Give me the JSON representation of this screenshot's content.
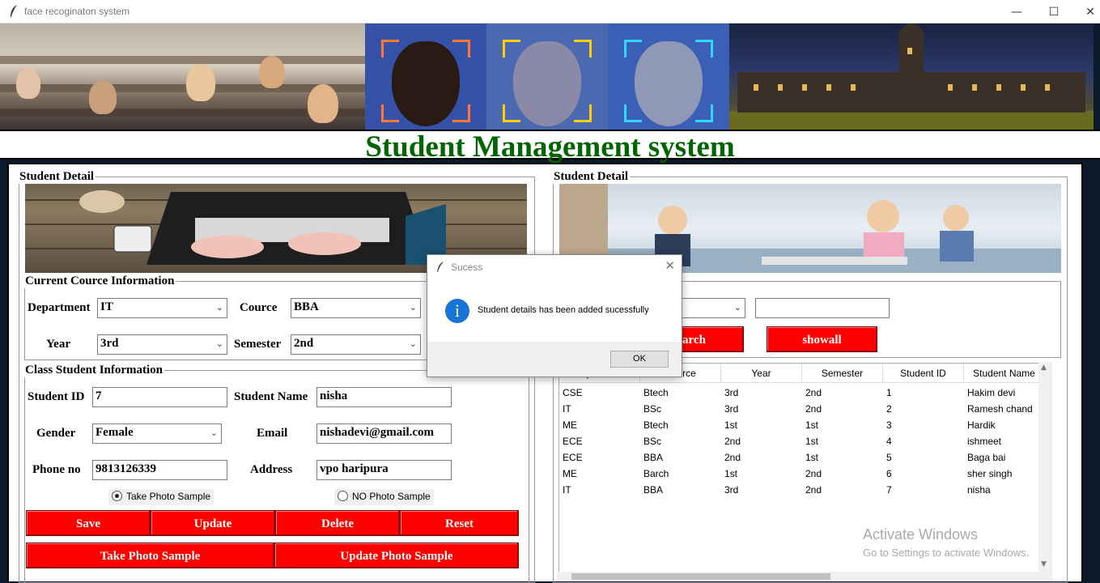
{
  "window": {
    "title": "face recoginaton system",
    "minimize": "—",
    "maximize": "☐",
    "close": "✕"
  },
  "header": {
    "title": "Student Management system"
  },
  "left_panel": {
    "label": "Student Detail",
    "course_group": {
      "label": "Current Cource Information",
      "department_label": "Department",
      "department_value": "IT",
      "course_label": "Cource",
      "course_value": "BBA",
      "year_label": "Year",
      "year_value": "3rd",
      "semester_label": "Semester",
      "semester_value": "2nd"
    },
    "class_group": {
      "label": "Class Student Information",
      "student_id_label": "Student ID",
      "student_id_value": "7",
      "student_name_label": "Student Name",
      "student_name_value": "nisha",
      "gender_label": "Gender",
      "gender_value": "Female",
      "email_label": "Email",
      "email_value": "nishadevi@gmail.com",
      "phone_label": "Phone no",
      "phone_value": "9813126339",
      "address_label": "Address",
      "address_value": "vpo haripura",
      "radio_take": "Take Photo Sample",
      "radio_no": "NO Photo Sample"
    },
    "buttons": {
      "save": "Save",
      "update": "Update",
      "delete": "Delete",
      "reset": "Reset",
      "take_photo": "Take Photo Sample",
      "update_photo": "Update Photo Sample"
    }
  },
  "right_panel": {
    "label": "Student Detail",
    "search_button": "Search",
    "showall_button": "showall",
    "table": {
      "columns": [
        "Department",
        "Cource",
        "Year",
        "Semester",
        "Student ID",
        "Student Name"
      ],
      "rows": [
        [
          "CSE",
          "Btech",
          "3rd",
          "2nd",
          "1",
          "Hakim devi"
        ],
        [
          "IT",
          "BSc",
          "3rd",
          "2nd",
          "2",
          "Ramesh chand"
        ],
        [
          "ME",
          "Btech",
          "1st",
          "1st",
          "3",
          "Hardik"
        ],
        [
          "ECE",
          "BSc",
          "2nd",
          "1st",
          "4",
          "ishmeet"
        ],
        [
          "ECE",
          "BBA",
          "2nd",
          "1st",
          "5",
          "Baga bai"
        ],
        [
          "ME",
          "Barch",
          "1st",
          "2nd",
          "6",
          "sher singh"
        ],
        [
          "IT",
          "BBA",
          "3rd",
          "2nd",
          "7",
          "nisha"
        ]
      ]
    }
  },
  "dialog": {
    "title": "Sucess",
    "close": "✕",
    "message": "Student details has been added sucessfully",
    "ok": "OK"
  },
  "watermark": {
    "line1": "Activate Windows",
    "line2": "Go to Settings to activate Windows."
  },
  "colors": {
    "heading": "#006400",
    "button": "#ff0000",
    "info": "#1a74d4"
  }
}
